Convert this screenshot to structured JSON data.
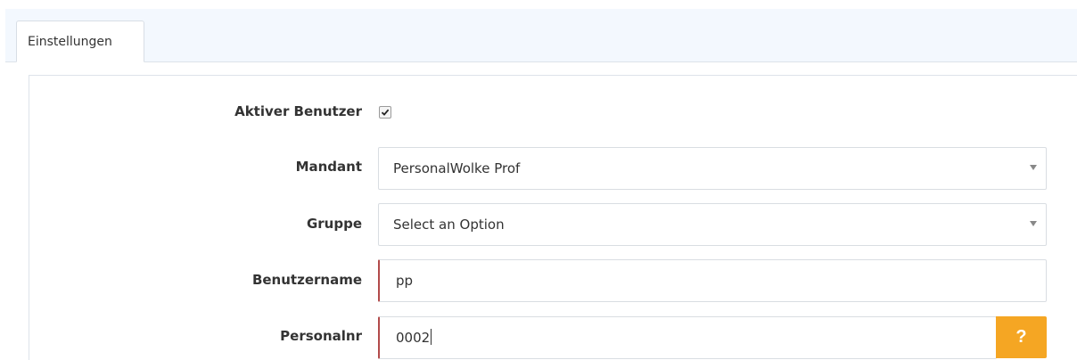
{
  "tabs": [
    {
      "label": "Einstellungen",
      "active": true
    }
  ],
  "form": {
    "active_user": {
      "label": "Aktiver Benutzer",
      "checked": true
    },
    "mandant": {
      "label": "Mandant",
      "value": "PersonalWolke Prof"
    },
    "gruppe": {
      "label": "Gruppe",
      "value": "Select an Option"
    },
    "benutzername": {
      "label": "Benutzername",
      "value": "pp"
    },
    "personalnr": {
      "label": "Personalnr",
      "value": "0002",
      "help_label": "?"
    }
  },
  "colors": {
    "tab_strip_bg": "#f3f8fe",
    "required_border": "#b24a4a",
    "help_button": "#f5a623"
  },
  "icons": {
    "checkbox": "check-icon",
    "dropdown": "chevron-down-icon",
    "help": "question-icon"
  }
}
